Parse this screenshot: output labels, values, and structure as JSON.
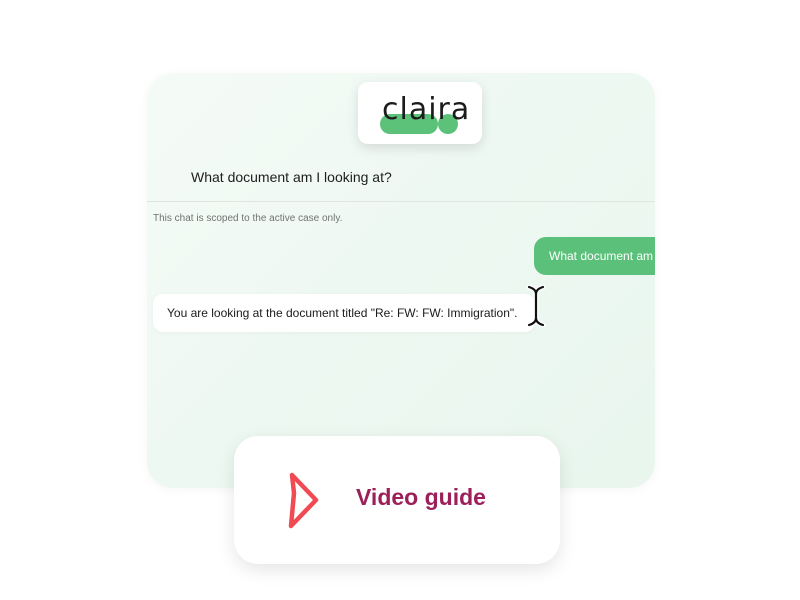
{
  "logo": {
    "text": "claira",
    "accent_color": "#5cc27a"
  },
  "chat": {
    "header_question": "What document am I looking at?",
    "scope_note": "This chat is scoped to the active case only.",
    "user_message": "What document am I looking at?",
    "assistant_message": "You are looking at the document titled \"Re: FW: FW: Immigration\"."
  },
  "cursor": {
    "icon": "text-cursor-icon"
  },
  "video_guide": {
    "label": "Video guide",
    "icon": "play-icon",
    "label_color": "#9c1f5a",
    "icon_color": "#f24a54"
  }
}
